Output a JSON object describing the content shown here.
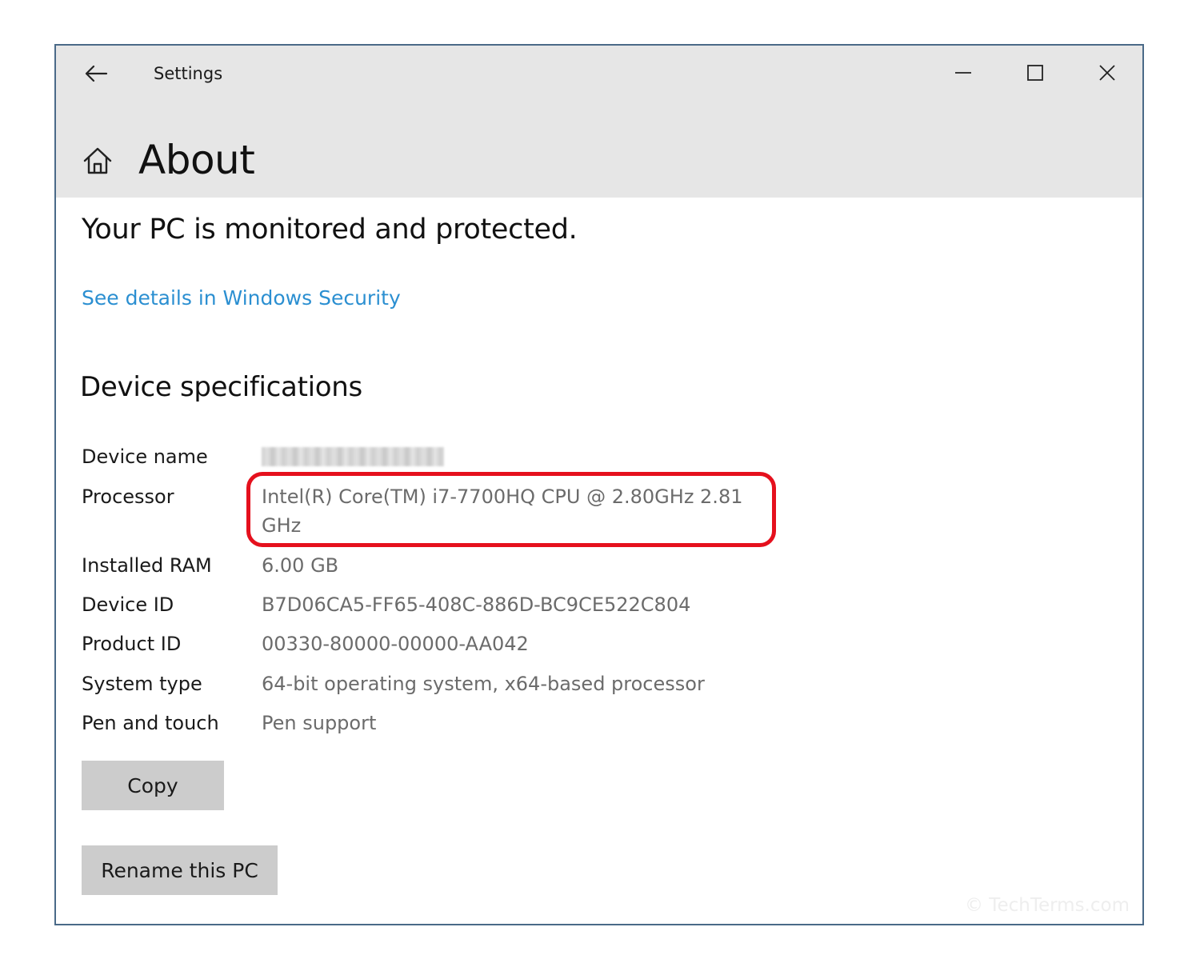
{
  "window": {
    "title": "Settings"
  },
  "page": {
    "title": "About"
  },
  "security": {
    "status_text": "Your PC is monitored and protected.",
    "link_text": "See details in Windows Security"
  },
  "device_specs": {
    "heading": "Device specifications",
    "device_name": {
      "label": "Device name",
      "value": ""
    },
    "processor": {
      "label": "Processor",
      "value": "Intel(R) Core(TM) i7-7700HQ CPU @ 2.80GHz   2.81 GHz"
    },
    "ram": {
      "label": "Installed RAM",
      "value": "6.00 GB"
    },
    "device_id": {
      "label": "Device ID",
      "value": "B7D06CA5-FF65-408C-886D-BC9CE522C804"
    },
    "product_id": {
      "label": "Product ID",
      "value": "00330-80000-00000-AA042"
    },
    "system_type": {
      "label": "System type",
      "value": "64-bit operating system, x64-based processor"
    },
    "pen_touch": {
      "label": "Pen and touch",
      "value": "Pen support"
    }
  },
  "buttons": {
    "copy": "Copy",
    "rename": "Rename this PC"
  },
  "watermark": "© TechTerms.com",
  "colors": {
    "titlebar_bg": "#e6e6e6",
    "link": "#2b8fd1",
    "highlight": "#e5101d",
    "button_bg": "#cccccc"
  },
  "icons": {
    "back": "back-arrow-icon",
    "minimize": "minimize-icon",
    "maximize": "maximize-icon",
    "close": "close-icon",
    "home": "home-icon"
  }
}
